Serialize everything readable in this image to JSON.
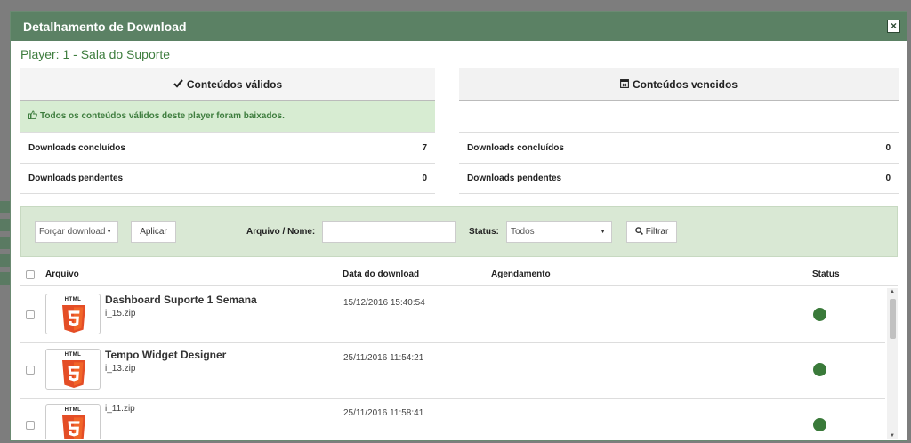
{
  "modal": {
    "title": "Detalhamento de Download",
    "close_label": "×"
  },
  "player": "Player: 1 - Sala do Suporte",
  "valid": {
    "title": "Conteúdos válidos",
    "alert": "Todos os conteúdos válidos deste player foram baixados.",
    "completed_label": "Downloads concluídos",
    "completed_value": "7",
    "pending_label": "Downloads pendentes",
    "pending_value": "0"
  },
  "expired": {
    "title": "Conteúdos vencidos",
    "completed_label": "Downloads concluídos",
    "completed_value": "0",
    "pending_label": "Downloads pendentes",
    "pending_value": "0"
  },
  "filter": {
    "action_select": "Forçar download",
    "apply_label": "Aplicar",
    "file_label": "Arquivo / Nome:",
    "file_value": "",
    "status_label": "Status:",
    "status_select": "Todos",
    "filter_label": "Filtrar"
  },
  "table": {
    "headers": {
      "file": "Arquivo",
      "date": "Data do download",
      "schedule": "Agendamento",
      "status": "Status"
    },
    "rows": [
      {
        "name": "Dashboard Suporte 1 Semana",
        "file": "i_15.zip",
        "date": "15/12/2016 15:40:54",
        "schedule": "",
        "status_color": "#3a7a3a"
      },
      {
        "name": "Tempo Widget Designer",
        "file": "i_13.zip",
        "date": "25/11/2016 11:54:21",
        "schedule": "",
        "status_color": "#3a7a3a"
      },
      {
        "name": "",
        "file": "i_11.zip",
        "date": "25/11/2016 11:58:41",
        "schedule": "",
        "status_color": "#3a7a3a"
      }
    ],
    "thumb_label": "HTML"
  },
  "colors": {
    "header_bg": "#5b8164",
    "success_text": "#3e7d3e",
    "alert_bg": "#d7ecd2",
    "filter_bg": "#d9e8d4",
    "html5_orange": "#e44d26"
  },
  "icons": {
    "check": "check-icon",
    "calendar": "calendar-icon",
    "thumbs_up": "thumbs-up-icon",
    "search": "search-icon",
    "close": "close-icon"
  }
}
